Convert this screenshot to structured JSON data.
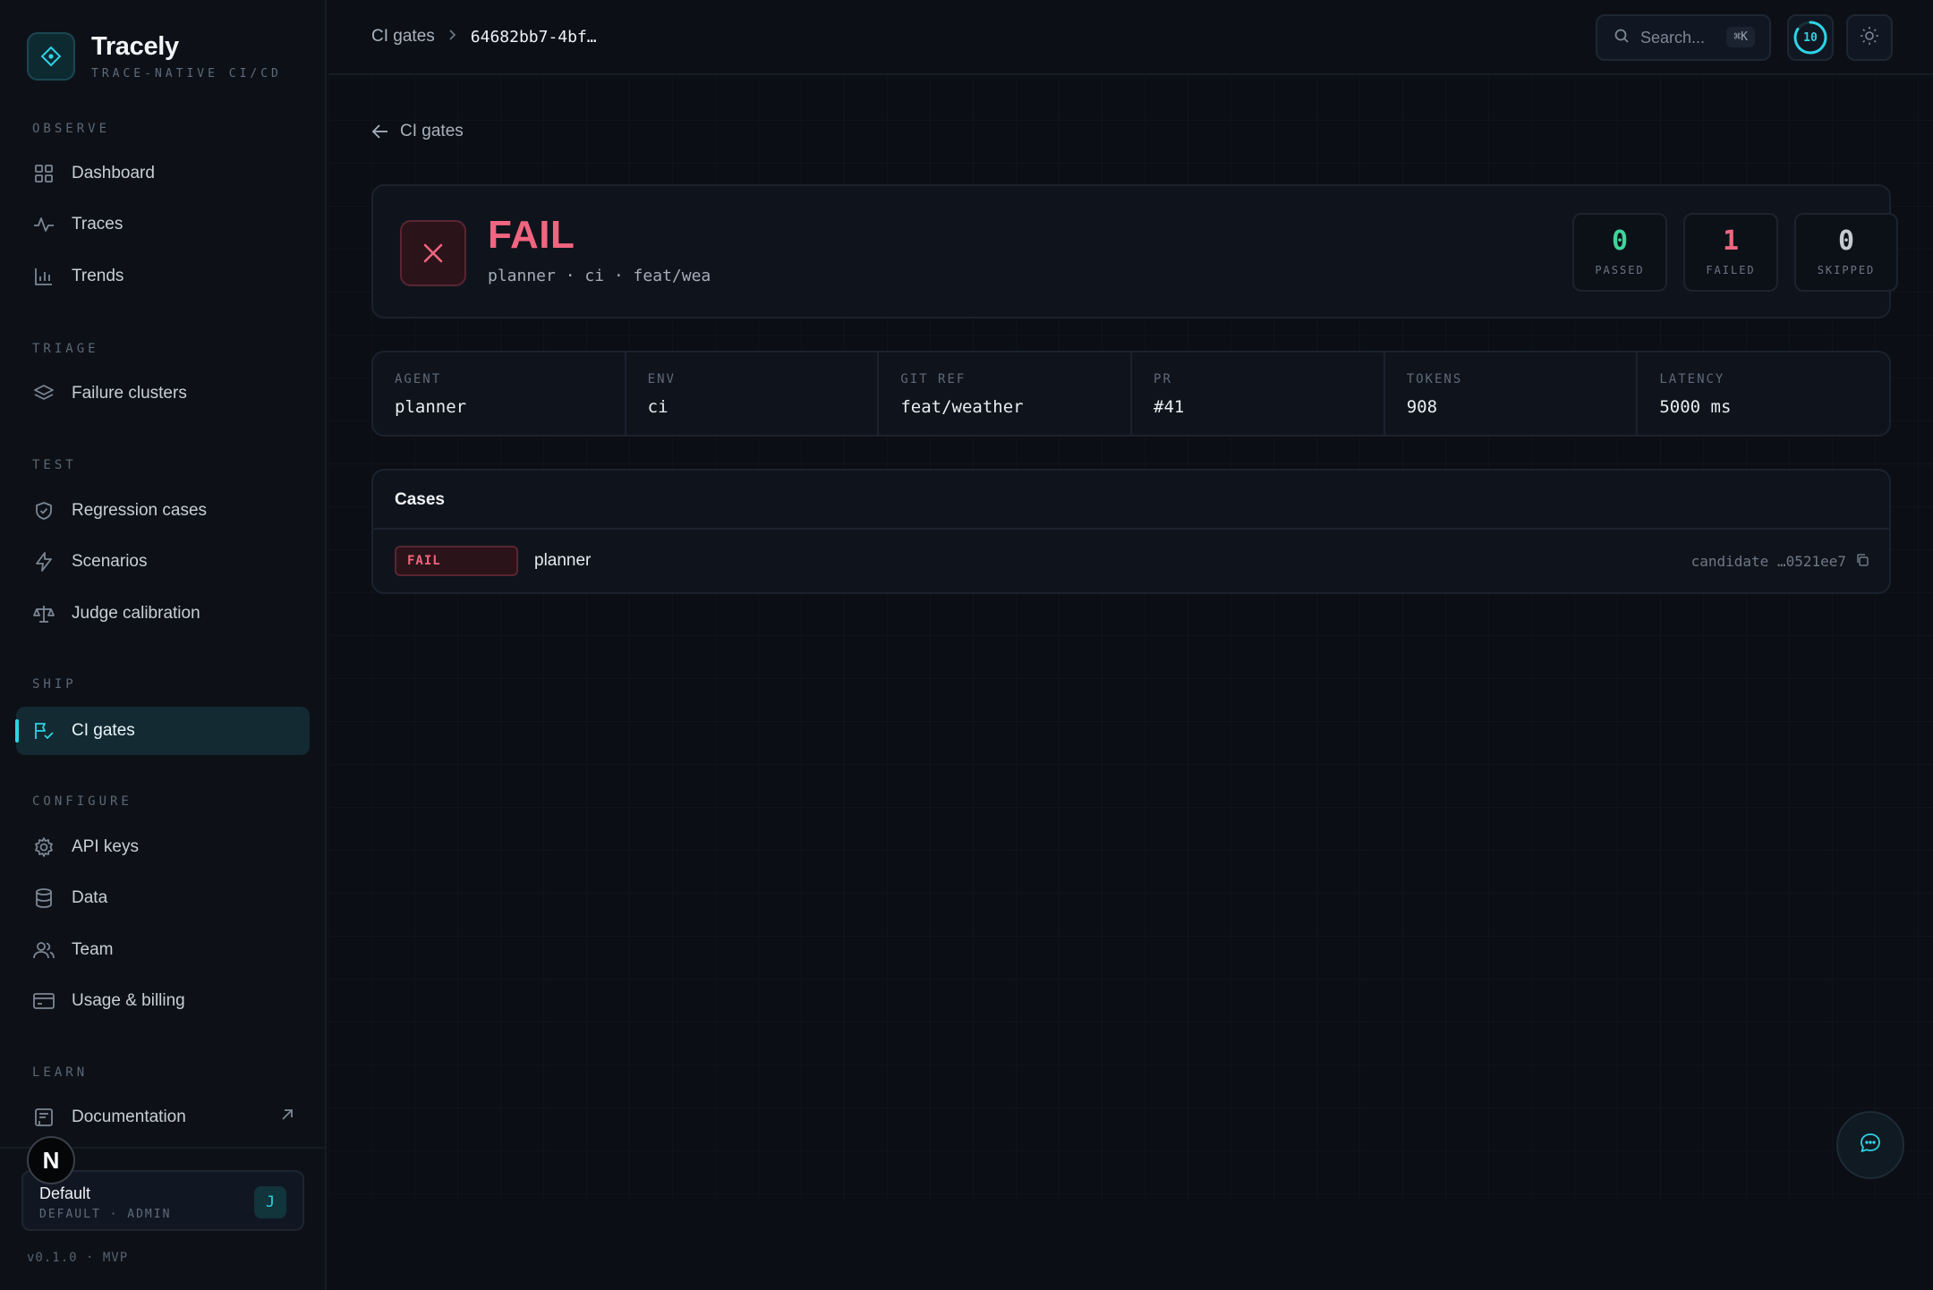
{
  "brand": {
    "name": "Tracely",
    "tagline": "TRACE-NATIVE CI/CD"
  },
  "sidebar": {
    "sections": [
      {
        "label": "OBSERVE",
        "items": [
          {
            "label": "Dashboard",
            "icon": "grid-icon"
          },
          {
            "label": "Traces",
            "icon": "pulse-icon"
          },
          {
            "label": "Trends",
            "icon": "bar-chart-icon"
          }
        ]
      },
      {
        "label": "TRIAGE",
        "items": [
          {
            "label": "Failure clusters",
            "icon": "layers-icon"
          }
        ]
      },
      {
        "label": "TEST",
        "items": [
          {
            "label": "Regression cases",
            "icon": "shield-icon"
          },
          {
            "label": "Scenarios",
            "icon": "bolt-icon"
          },
          {
            "label": "Judge calibration",
            "icon": "scale-icon"
          }
        ]
      },
      {
        "label": "SHIP",
        "items": [
          {
            "label": "CI gates",
            "icon": "flag-check-icon",
            "active": true
          }
        ]
      },
      {
        "label": "CONFIGURE",
        "items": [
          {
            "label": "API keys",
            "icon": "gear-icon"
          },
          {
            "label": "Data",
            "icon": "database-icon"
          },
          {
            "label": "Team",
            "icon": "users-icon"
          },
          {
            "label": "Usage & billing",
            "icon": "card-icon"
          }
        ]
      },
      {
        "label": "LEARN",
        "items": [
          {
            "label": "Documentation",
            "icon": "book-icon",
            "external": true
          }
        ]
      }
    ],
    "workspace": {
      "name": "Default",
      "sub": "DEFAULT · ADMIN",
      "avatar": "J"
    },
    "badge": "N",
    "version": "v0.1.0 · MVP"
  },
  "topbar": {
    "breadcrumb": [
      "CI gates",
      "64682bb7-4bf…"
    ],
    "search_placeholder": "Search...",
    "search_shortcut": "⌘K",
    "ring_value": "10"
  },
  "page": {
    "back_label": "CI gates",
    "status": {
      "title": "FAIL",
      "subtitle": "planner · ci · feat/wea",
      "stats": [
        {
          "value": "0",
          "label": "PASSED",
          "color": "#3fd49a"
        },
        {
          "value": "1",
          "label": "FAILED",
          "color": "#f0657f"
        },
        {
          "value": "0",
          "label": "SKIPPED",
          "color": "#c5cbd3"
        }
      ]
    },
    "meta": [
      {
        "key": "AGENT",
        "value": "planner"
      },
      {
        "key": "ENV",
        "value": "ci"
      },
      {
        "key": "GIT REF",
        "value": "feat/weather"
      },
      {
        "key": "PR",
        "value": "#41"
      },
      {
        "key": "TOKENS",
        "value": "908"
      },
      {
        "key": "LATENCY",
        "value": "5000 ms"
      }
    ],
    "cases": {
      "title": "Cases",
      "rows": [
        {
          "status": "FAIL",
          "name": "planner",
          "candidate": "candidate …0521ee7"
        }
      ]
    }
  },
  "colors": {
    "accent": "#2dd4e6",
    "fail": "#f0657f",
    "pass": "#3fd49a",
    "background": "#0b0e14"
  }
}
